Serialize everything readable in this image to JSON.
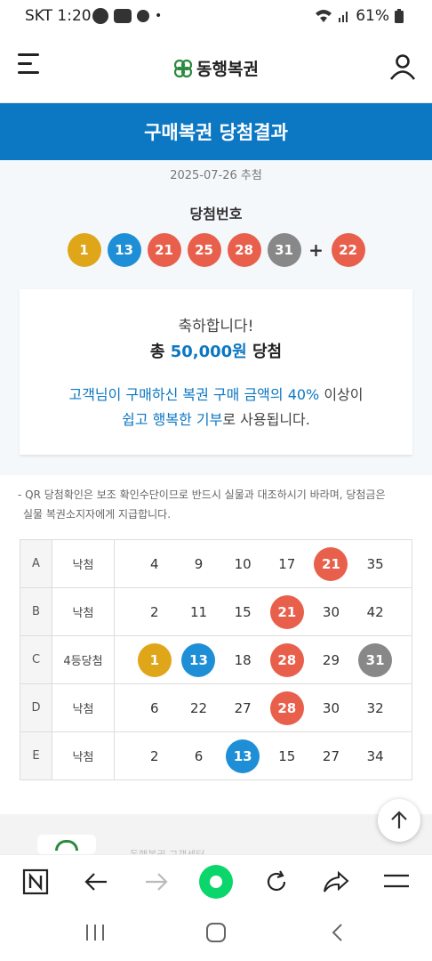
{
  "status_bar": {
    "carrier_time": "SKT 1:20",
    "battery": "61%",
    "dot": "•"
  },
  "header": {
    "logo_text": "동행복권"
  },
  "banner": {
    "title": "구매복권 당첨결과"
  },
  "draw": {
    "date": "2025-07-26 추첨",
    "label": "당첨번호",
    "numbers": [
      "1",
      "13",
      "21",
      "25",
      "28",
      "31"
    ],
    "number_colors": [
      "yellow",
      "blue",
      "red",
      "red",
      "red",
      "gray"
    ],
    "plus": "+",
    "bonus": "22",
    "bonus_color": "red"
  },
  "result_card": {
    "congrats": "축하합니다!",
    "prize_prefix": "총 ",
    "prize_amount": "50,000원",
    "prize_suffix": " 당첨",
    "msg1_blue": "고객님이 구매하신 복권 구매 금액의 40%",
    "msg1_plain": " 이상이",
    "msg2_blue": "쉽고 행복한 기부",
    "msg2_plain": "로 사용됩니다."
  },
  "notice": {
    "line1": "- QR 당첨확인은 보조 확인수단이므로 반드시 실물과 대조하시기 바라며, 당첨금은",
    "line2": "  실물 복권소지자에게 지급합니다."
  },
  "games": [
    {
      "id": "A",
      "result": "낙첨",
      "nums": [
        {
          "n": "4",
          "c": ""
        },
        {
          "n": "9",
          "c": ""
        },
        {
          "n": "10",
          "c": ""
        },
        {
          "n": "17",
          "c": ""
        },
        {
          "n": "21",
          "c": "r"
        },
        {
          "n": "35",
          "c": ""
        }
      ]
    },
    {
      "id": "B",
      "result": "낙첨",
      "nums": [
        {
          "n": "2",
          "c": ""
        },
        {
          "n": "11",
          "c": ""
        },
        {
          "n": "15",
          "c": ""
        },
        {
          "n": "21",
          "c": "r"
        },
        {
          "n": "30",
          "c": ""
        },
        {
          "n": "42",
          "c": ""
        }
      ]
    },
    {
      "id": "C",
      "result": "4등당첨",
      "nums": [
        {
          "n": "1",
          "c": "y"
        },
        {
          "n": "13",
          "c": "b"
        },
        {
          "n": "18",
          "c": ""
        },
        {
          "n": "28",
          "c": "r"
        },
        {
          "n": "29",
          "c": ""
        },
        {
          "n": "31",
          "c": "g"
        }
      ]
    },
    {
      "id": "D",
      "result": "낙첨",
      "nums": [
        {
          "n": "6",
          "c": ""
        },
        {
          "n": "22",
          "c": ""
        },
        {
          "n": "27",
          "c": ""
        },
        {
          "n": "28",
          "c": "r"
        },
        {
          "n": "30",
          "c": ""
        },
        {
          "n": "32",
          "c": ""
        }
      ]
    },
    {
      "id": "E",
      "result": "낙첨",
      "nums": [
        {
          "n": "2",
          "c": ""
        },
        {
          "n": "6",
          "c": ""
        },
        {
          "n": "13",
          "c": "b"
        },
        {
          "n": "15",
          "c": ""
        },
        {
          "n": "27",
          "c": ""
        },
        {
          "n": "34",
          "c": ""
        }
      ]
    }
  ],
  "footer": {
    "text": "동행복권 고객센터"
  },
  "colors": {
    "brand_blue": "#0c77c2",
    "ball_yellow": "#e0a619",
    "ball_blue": "#1e8fd6",
    "ball_red": "#e8604c",
    "ball_gray": "#888888",
    "logo_green": "#2a8a3e"
  },
  "icons": {
    "menu": "hamburger-icon",
    "user": "user-icon",
    "scroll_top": "arrow-up-icon",
    "toolbar": [
      "naver-n-icon",
      "back-arrow-icon",
      "forward-arrow-icon",
      "green-dot-icon",
      "reload-icon",
      "share-icon",
      "menu-lines-icon"
    ],
    "android_nav": [
      "recents-icon",
      "home-icon",
      "back-icon"
    ]
  }
}
